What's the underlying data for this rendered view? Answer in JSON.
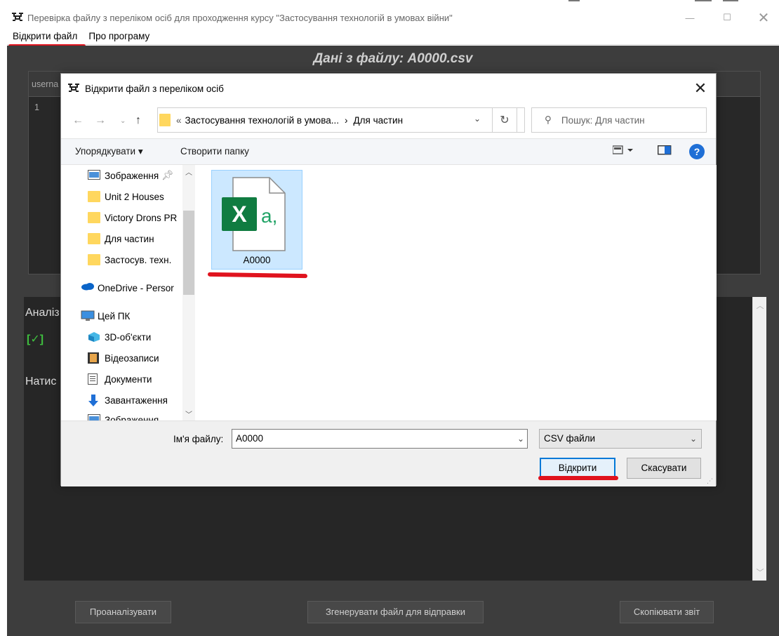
{
  "window": {
    "title": "Перевірка файлу з переліком осіб для проходження курсу \"Застосування технологій в умовах війни\"",
    "menu": [
      "Відкрити файл",
      "Про програму"
    ]
  },
  "main": {
    "heading": "Дані з файлу: A0000.csv",
    "table_header_partial": "userna",
    "row_number": "1",
    "report_line1_partial": "Аналіз",
    "report_check": "[✓]",
    "report_line3_partial": "Натис",
    "buttons": {
      "analyze": "Проаналізувати",
      "generate": "Згенерувати файл для відправки",
      "copy": "Скопіювати звіт"
    }
  },
  "dialog": {
    "title": "Відкрити файл з переліком осіб",
    "breadcrumb": {
      "prefix": "«",
      "parent": "Застосування технологій в умова...",
      "separator": "›",
      "current": "Для частин"
    },
    "search_placeholder": "Пошук: Для частин",
    "toolbar": {
      "organize": "Упорядкувати ▾",
      "new_folder": "Створити папку"
    },
    "nav_items": [
      {
        "label": "Зображення",
        "icon": "pictures-icon",
        "pinned": true
      },
      {
        "label": "Unit 2 Houses",
        "icon": "folder-icon"
      },
      {
        "label": "Victory Drons PR",
        "icon": "folder-icon"
      },
      {
        "label": "Для частин",
        "icon": "folder-icon"
      },
      {
        "label": "Застосув. техн.",
        "icon": "folder-icon"
      },
      {
        "label": "OneDrive - Persor",
        "icon": "onedrive-icon"
      },
      {
        "label": "Цей ПК",
        "icon": "computer-icon"
      },
      {
        "label": "3D-об'єкти",
        "icon": "3d-objects-icon"
      },
      {
        "label": "Відеозаписи",
        "icon": "videos-icon"
      },
      {
        "label": "Документи",
        "icon": "documents-icon"
      },
      {
        "label": "Завантаження",
        "icon": "downloads-icon"
      },
      {
        "label": "Зображення",
        "icon": "pictures-icon"
      }
    ],
    "file": {
      "name": "A0000",
      "icon_letter": "X",
      "icon_suffix": "a,"
    },
    "filename_label": "Ім'я файлу:",
    "filename_value": "A0000",
    "filetype": "CSV файли",
    "buttons": {
      "open": "Відкрити",
      "cancel": "Скасувати"
    }
  },
  "colors": {
    "annotation_red": "#e0131e",
    "app_background": "#3d3d3d",
    "selection_blue": "#cce8ff",
    "excel_green": "#107c41"
  }
}
